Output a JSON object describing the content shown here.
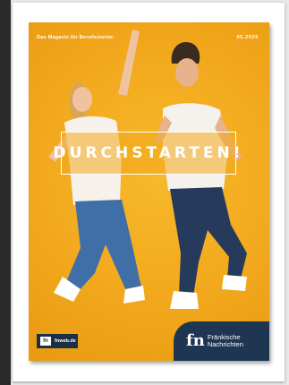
{
  "cover": {
    "tagline": "Das Magazin für Berufsstarter.",
    "issue": "05.2025",
    "title": "DURCHSTARTEN!",
    "badge": {
      "logo": "fn",
      "url": "fnweb.de"
    },
    "brand": {
      "mark": "fn",
      "name_line1": "Fränkische",
      "name_line2": "Nachrichten"
    },
    "colors": {
      "background": "#f2a81c",
      "brand_navy": "#1f3652"
    }
  }
}
